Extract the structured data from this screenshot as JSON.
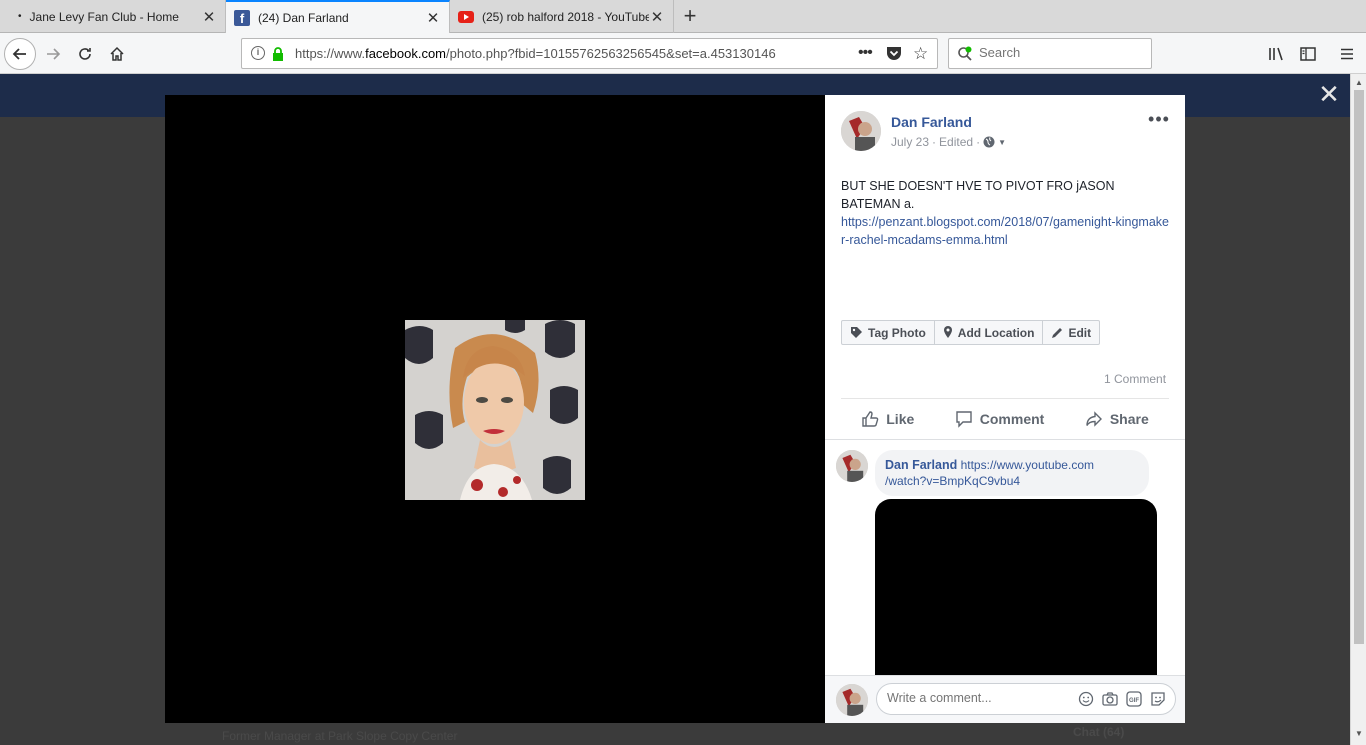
{
  "browser": {
    "tabs": [
      {
        "title": "Jane Levy Fan Club - Home",
        "favicon": "dot-icon",
        "active": false
      },
      {
        "title": "(24) Dan Farland",
        "favicon": "facebook-icon",
        "active": true
      },
      {
        "title": "(25) rob halford 2018 - YouTube",
        "favicon": "youtube-icon",
        "active": false
      }
    ],
    "url_prefix": "https://www.",
    "url_host": "facebook.com",
    "url_rest": "/photo.php?fbid=10155762563256545&set=a.453130146",
    "search_placeholder": "Search"
  },
  "background": {
    "profile_line_prefix": "Former Manager at",
    "profile_line_place": "Park Slope Copy Center",
    "chat_label": "Chat (64)"
  },
  "post": {
    "author": "Dan Farland",
    "date": "July 23",
    "edited": "Edited",
    "meta_separator": "·",
    "text_line1": "BUT SHE DOESN'T HVE TO PIVOT FRO jASON",
    "text_line2": "BATEMAN a.",
    "link": "https://penzant.blogspot.com/2018/07/gamenight-kingmaker-rachel-mcadams-emma.html",
    "photo_actions": {
      "tag_photo": "Tag Photo",
      "add_location": "Add Location",
      "edit": "Edit"
    },
    "comment_count": "1 Comment",
    "actions": {
      "like": "Like",
      "comment": "Comment",
      "share": "Share"
    }
  },
  "comment": {
    "author": "Dan Farland",
    "link_line1": "https://www.youtube.com",
    "link_line2": "/watch?v=BmpKqC9vbu4"
  },
  "composer": {
    "placeholder": "Write a comment..."
  }
}
